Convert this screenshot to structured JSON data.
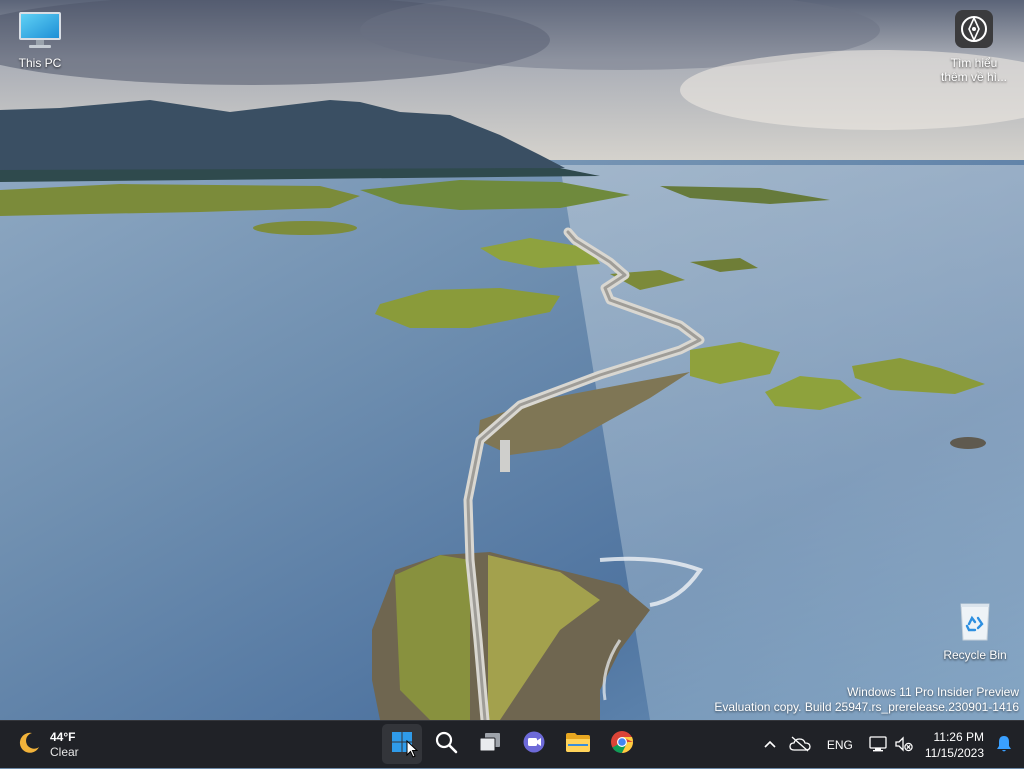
{
  "desktop": {
    "icons": {
      "this_pc": {
        "label": "This PC",
        "icon": "monitor-icon"
      },
      "get_started": {
        "label": "Tìm hiểu thêm về hì...",
        "icon": "get-started-icon"
      },
      "recycle_bin": {
        "label": "Recycle Bin",
        "icon": "recycle-bin-icon"
      }
    },
    "watermark": {
      "line1": "Windows 11 Pro Insider Preview",
      "line2": "Evaluation copy. Build 25947.rs_prerelease.230901-1416"
    }
  },
  "taskbar": {
    "weather": {
      "temp": "44°F",
      "condition": "Clear",
      "icon": "moon-icon"
    },
    "apps": [
      {
        "name": "start",
        "icon": "windows-logo-icon"
      },
      {
        "name": "search",
        "icon": "search-icon"
      },
      {
        "name": "task-view",
        "icon": "task-view-icon"
      },
      {
        "name": "teams-chat",
        "icon": "teams-icon"
      },
      {
        "name": "file-explorer",
        "icon": "folder-icon"
      },
      {
        "name": "chrome",
        "icon": "chrome-icon"
      }
    ],
    "tray": {
      "language": "ENG",
      "time": "11:26 PM",
      "date": "11/15/2023"
    }
  },
  "colors": {
    "taskbar_bg": "#202227",
    "windows_blue": "#2f9bea",
    "sea": "#5d82a8"
  }
}
